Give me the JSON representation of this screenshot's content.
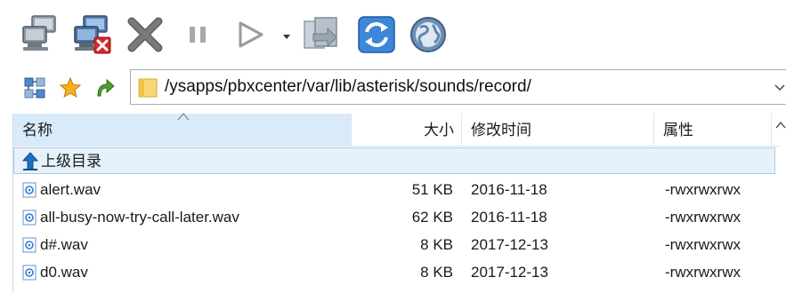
{
  "toolbar": {
    "buttons": [
      {
        "name": "connect-icon"
      },
      {
        "name": "disconnect-icon"
      },
      {
        "name": "cancel-icon"
      },
      {
        "name": "pause-icon"
      },
      {
        "name": "play-icon"
      },
      {
        "name": "transfer-queue-icon"
      },
      {
        "name": "refresh-icon"
      },
      {
        "name": "globe-icon"
      }
    ]
  },
  "address": {
    "path": "/ysapps/pbxcenter/var/lib/asterisk/sounds/record/"
  },
  "columns": {
    "name": "名称",
    "size": "大小",
    "modified": "修改时间",
    "attributes": "属性"
  },
  "parent_dir_label": "上级目录",
  "files": [
    {
      "name": "alert.wav",
      "size": "51 KB",
      "modified": "2016-11-18",
      "attributes": "-rwxrwxrwx"
    },
    {
      "name": "all-busy-now-try-call-later.wav",
      "size": "62 KB",
      "modified": "2016-11-18",
      "attributes": "-rwxrwxrwx"
    },
    {
      "name": "d#.wav",
      "size": "8 KB",
      "modified": "2017-12-13",
      "attributes": "-rwxrwxrwx"
    },
    {
      "name": "d0.wav",
      "size": "8 KB",
      "modified": "2017-12-13",
      "attributes": "-rwxrwxrwx"
    }
  ]
}
